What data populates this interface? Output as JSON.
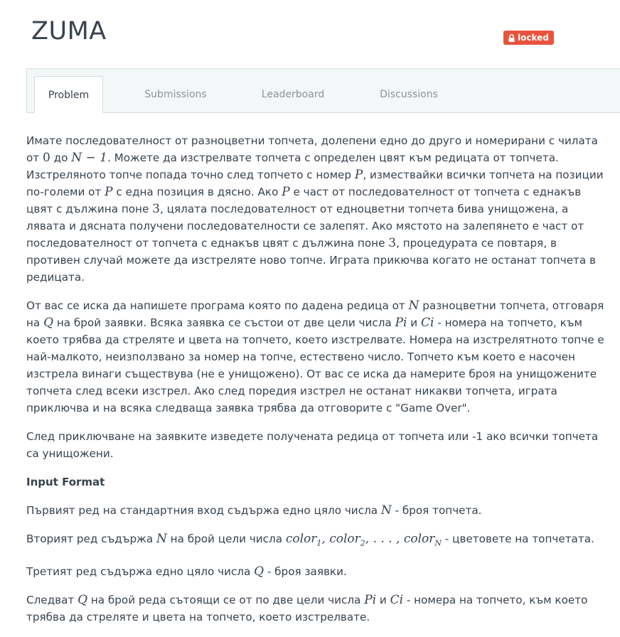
{
  "header": {
    "title": "ZUMA",
    "badge_label": "locked",
    "badge_color": "#e8533f"
  },
  "tabs": [
    {
      "label": "Problem",
      "active": true
    },
    {
      "label": "Submissions",
      "active": false
    },
    {
      "label": "Leaderboard",
      "active": false
    },
    {
      "label": "Discussions",
      "active": false
    }
  ],
  "problem": {
    "p1": {
      "s1": "Имате последователност от разноцветни топчета, долепени едно до друго и номерирани с чилата от ",
      "m1": "0",
      "s2": " до ",
      "m2": "N − 1",
      "s3": ". Можете да изстрелвате топчета с определен цвят към редицата от топчета. Изстреляното топче попада точно след топчето с номер ",
      "m3": "P",
      "s4": ", измествайки всички топчета на позиции по-големи от ",
      "m4": "P",
      "s5": " с една позиция в дясно. Ако ",
      "m5": "P",
      "s6": " е част от последователност от топчета с еднакъв цвят с дължина поне ",
      "m6": "3",
      "s7": ", цялата последователност от едноцветни топчета бива унищожена, а лявата и дясната получени последователности се залепят. Ако мястото на залепянето е част от последователност от топчета с еднакъв цвят с дължина поне ",
      "m7": "3",
      "s8": ", процедурата се повтаря, в противен случай можете да изстреляте ново топче. Играта прикючва когато не останат топчета в редицата."
    },
    "p2": {
      "s1": "От вас се иска да напишете програма която по дадена редица от ",
      "m1": "N",
      "s2": " разноцветни топчета, отговаря на ",
      "m2": "Q",
      "s3": " на брой заявки. Всяка заявка се състои от две цели числа ",
      "m3": "Pi",
      "s4": " и ",
      "m4": "Ci",
      "s5": " - номера на топчето, към което трябва да стреляте и цвета на топчето, което изстрелвате. Номера на изстрелятното топче е най-малкото, неизползвано за номер на топче, естествено число. Топчето към което е насочен изстрела винаги съществува (не е унищожено). От вас се иска да намерите броя на унищожените топчета след всеки изстрел. Ако след поредия изстрел не останат никакви топчета, играта приключва и на всяка следваща заявка трябва да отговорите с \"Game Over\"."
    },
    "p3": "След приключване на заявките изведете получената редица от топчета или -1 ако всички топчета са унищожени.",
    "input_format_heading": "Input Format",
    "if1": {
      "s1": "Първият ред на стандартния вход съдържа едно цяло числа ",
      "m1": "N",
      "s2": " - броя топчета."
    },
    "if2": {
      "s1": "Вторият ред съдържа ",
      "m1": "N",
      "s2": " на брой цели числа ",
      "c": "color",
      "sub1": "1",
      "sub2": "2",
      "subN": "N",
      "dots": ", . . . , ",
      "s3": " - цветовете на топчетата."
    },
    "if3": {
      "s1": "Третият ред съдържа едно цяло числа ",
      "m1": "Q",
      "s2": " - броя заявки."
    },
    "if4": {
      "s1": "Следват ",
      "m1": "Q",
      "s2": " на брой реда сътоящи се от по две цели числа ",
      "m2": "Pi",
      "s3": " и ",
      "m3": "Ci",
      "s4": " - номера на топчето, към което трябва да стреляте и цвета на топчето, което изстрелвате."
    }
  }
}
